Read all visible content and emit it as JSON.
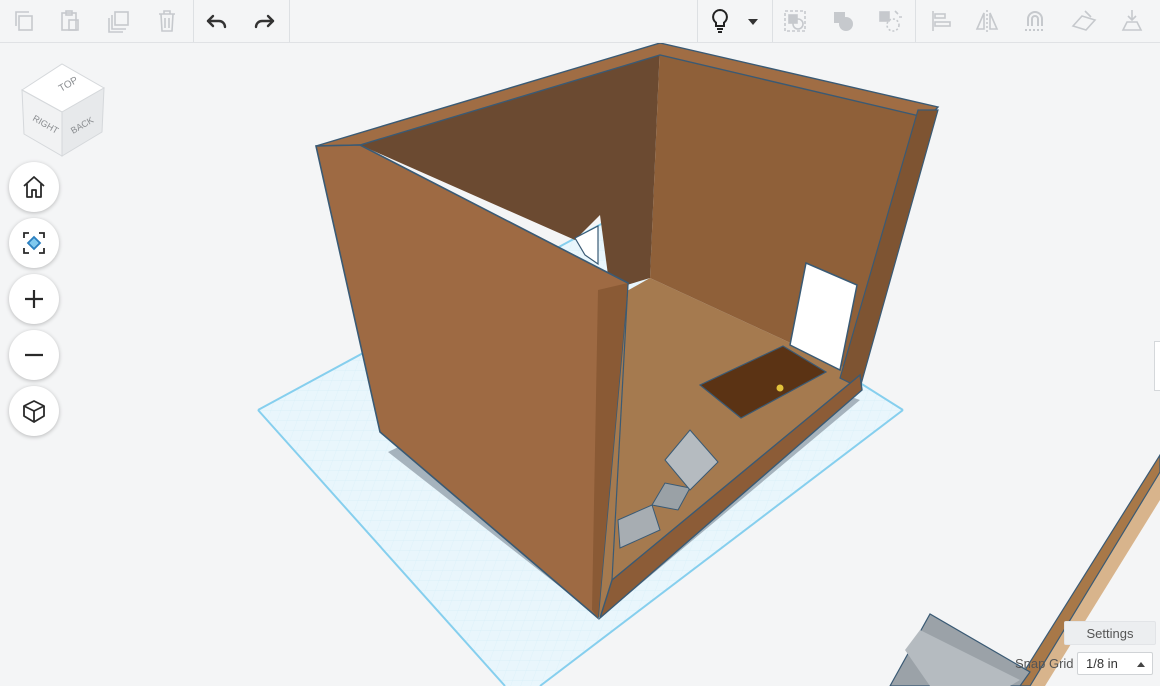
{
  "toolbar": {
    "left_tools": [
      "copy-icon",
      "paste-icon",
      "duplicate-icon",
      "delete-icon"
    ],
    "history_tools": [
      "undo-icon",
      "redo-icon"
    ],
    "right_tools": [
      "lightbulb-icon",
      "dropdown-arrow-icon",
      "group-icon",
      "ungroup-icon",
      "hole-solid-icon",
      "align-icon",
      "mirror-icon",
      "magnet-icon",
      "workplane-icon",
      "drop-icon"
    ]
  },
  "viewcube": {
    "top": "TOP",
    "right": "RIGHT",
    "back": "BACK"
  },
  "nav": [
    "home-view",
    "fit-view",
    "zoom-in",
    "zoom-out",
    "perspective-view"
  ],
  "settings": {
    "label": "Settings"
  },
  "snap_grid": {
    "label": "Snap Grid",
    "value": "1/8 in"
  },
  "colors": {
    "wall": "#97643d",
    "floor": "#a57a4f",
    "grid": "#bfe6f5",
    "accent": "#1a9bd7"
  }
}
